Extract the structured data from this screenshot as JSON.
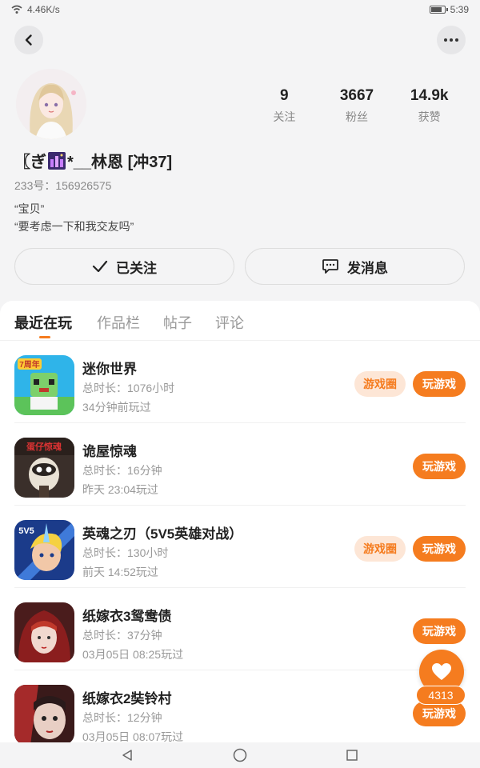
{
  "status_bar": {
    "speed": "4.46K/s",
    "time": "5:39",
    "wifi_icon": "wifi-icon",
    "battery_icon": "battery-icon"
  },
  "header": {
    "back_icon": "back-icon",
    "more_icon": "more-icon"
  },
  "profile": {
    "nickname_prefix": "〖ぎ",
    "nickname_suffix": "*__林恩 [冲37]",
    "uid": "233号：156926575",
    "bio_line1": "“宝贝”",
    "bio_line2": "“要考虑一下和我交友吗”",
    "stats": [
      {
        "value": "9",
        "label": "关注"
      },
      {
        "value": "3667",
        "label": "粉丝"
      },
      {
        "value": "14.9k",
        "label": "获赞"
      }
    ]
  },
  "actions": {
    "follow_label": "已关注",
    "message_label": "发消息"
  },
  "tabs": [
    "最近在玩",
    "作品栏",
    "帖子",
    "评论"
  ],
  "games": [
    {
      "name": "迷你世界",
      "duration": "总时长：1076小时",
      "last": "34分钟前玩过",
      "circle": "游戏圈",
      "play": "玩游戏"
    },
    {
      "name": "诡屋惊魂",
      "duration": "总时长：16分钟",
      "last": "昨天 23:04玩过",
      "play": "玩游戏"
    },
    {
      "name": "英魂之刃（5V5英雄对战）",
      "duration": "总时长：130小时",
      "last": "前天 14:52玩过",
      "circle": "游戏圈",
      "play": "玩游戏"
    },
    {
      "name": "纸嫁衣3鸳鸯债",
      "duration": "总时长：37分钟",
      "last": "03月05日 08:25玩过",
      "play": "玩游戏"
    },
    {
      "name": "纸嫁衣2奘铃村",
      "duration": "总时长：12分钟",
      "last": "03月05日 08:07玩过",
      "play": "玩游戏"
    }
  ],
  "game_icon_text": {
    "mini_world": "7周年",
    "haunted": "蛋仔惊魂",
    "hero": "5V5"
  },
  "like_fab": {
    "count": "4313",
    "icon": "heart-icon"
  },
  "colors": {
    "accent": "#f57c1f",
    "accent_light": "#fde6d6",
    "background": "#f4f4f5"
  }
}
